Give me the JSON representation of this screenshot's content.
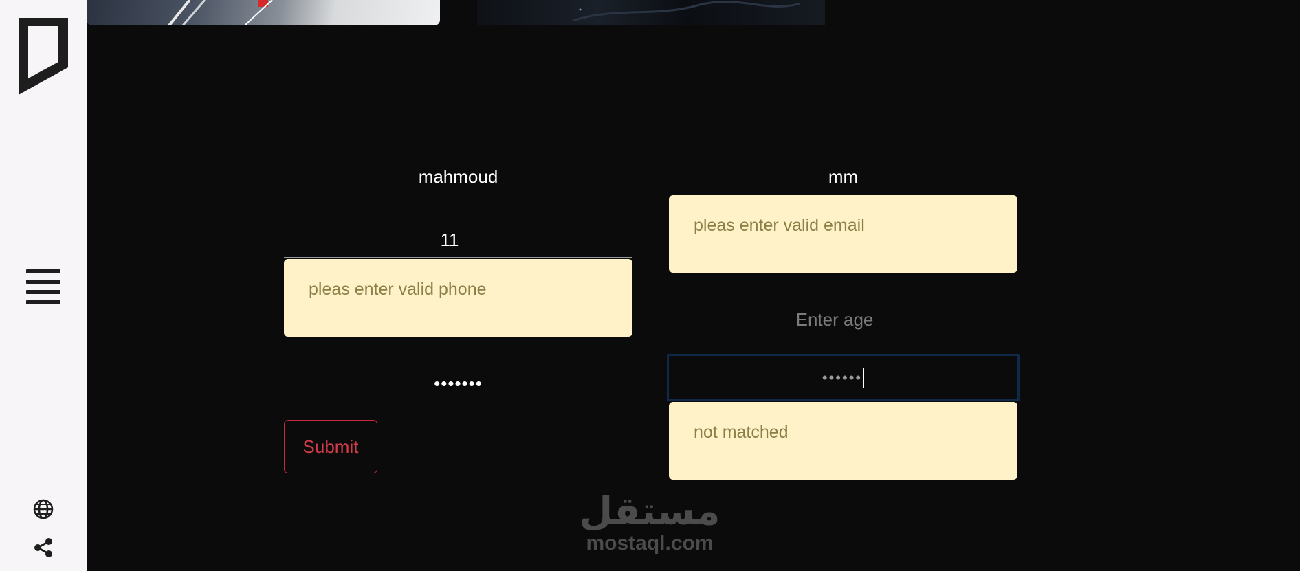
{
  "sidebar": {
    "logo_icon": "bookmark-logo",
    "menu_icon": "hamburger-menu-icon",
    "globe_icon": "globe-icon",
    "share_icon": "share-icon"
  },
  "form": {
    "first_name": "mahmoud",
    "last_name": "mm",
    "phone": "11",
    "age_placeholder": "Enter age",
    "password_mask": "•••••••",
    "confirm_password_mask": "••••••",
    "email_error": "pleas enter valid email",
    "phone_error": "pleas enter valid phone",
    "password_error": "not matched",
    "submit_label": "Submit"
  },
  "watermark": {
    "arabic": "مستقل",
    "latin": "mostaql.com"
  },
  "colors": {
    "background": "#0b0b0b",
    "sidebar": "#f7f5f7",
    "alert_bg": "#fff2c8",
    "alert_text": "#8b7f46",
    "submit_accent": "#d33a4a"
  }
}
